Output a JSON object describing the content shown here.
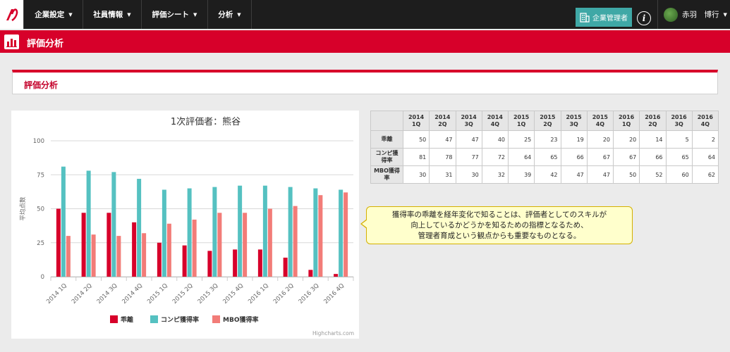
{
  "nav": {
    "items": [
      {
        "label": "企業設定"
      },
      {
        "label": "社員情報"
      },
      {
        "label": "評価シート"
      },
      {
        "label": "分析"
      }
    ],
    "admin_label": "企業管理者",
    "info_label": "i",
    "user_name": "赤羽　博行"
  },
  "header": {
    "title": "評価分析"
  },
  "panel": {
    "title": "評価分析"
  },
  "callout": {
    "lines": [
      "獲得率の乖離を経年変化で知ることは、評価者としてのスキルが",
      "向上しているかどうかを知るための指標となるため、",
      "管理者育成という観点からも重要なものとなる。"
    ]
  },
  "table": {
    "columns": [
      "2014 1Q",
      "2014 2Q",
      "2014 3Q",
      "2014 4Q",
      "2015 1Q",
      "2015 2Q",
      "2015 3Q",
      "2015 4Q",
      "2016 1Q",
      "2016 2Q",
      "2016 3Q",
      "2016 4Q"
    ],
    "rows": [
      {
        "label": "乖離",
        "values": [
          50,
          47,
          47,
          40,
          25,
          23,
          19,
          20,
          20,
          14,
          5,
          2
        ]
      },
      {
        "label": "コンピ獲得率",
        "values": [
          81,
          78,
          77,
          72,
          64,
          65,
          66,
          67,
          67,
          66,
          65,
          64
        ]
      },
      {
        "label": "MBO獲得率",
        "values": [
          30,
          31,
          30,
          32,
          39,
          42,
          47,
          47,
          50,
          52,
          60,
          62
        ]
      }
    ]
  },
  "chart_data": {
    "type": "bar",
    "title": "1次評価者：熊谷",
    "xlabel": "",
    "ylabel": "平均点数",
    "ylim": [
      0,
      100
    ],
    "yticks": [
      0,
      25,
      50,
      75,
      100
    ],
    "grid": true,
    "legend": "bottom",
    "credit": "Highcharts.com",
    "categories": [
      "2014 1Q",
      "2014 2Q",
      "2014 3Q",
      "2014 4Q",
      "2015 1Q",
      "2015 2Q",
      "2015 3Q",
      "2015 4Q",
      "2016 1Q",
      "2016 2Q",
      "2016 3Q",
      "2016 4Q"
    ],
    "series": [
      {
        "name": "乖離",
        "color": "#d7002a",
        "values": [
          50,
          47,
          47,
          40,
          25,
          23,
          19,
          20,
          20,
          14,
          5,
          2
        ]
      },
      {
        "name": "コンピ獲得率",
        "color": "#55c1c1",
        "values": [
          81,
          78,
          77,
          72,
          64,
          65,
          66,
          67,
          67,
          66,
          65,
          64
        ]
      },
      {
        "name": "MBO獲得率",
        "color": "#f27c78",
        "values": [
          30,
          31,
          30,
          32,
          39,
          42,
          47,
          47,
          50,
          52,
          60,
          62
        ]
      }
    ]
  },
  "colors": {
    "brand_red": "#d7002a",
    "nav_bg": "#1d1d1d",
    "admin_teal": "#3fa8a6"
  }
}
